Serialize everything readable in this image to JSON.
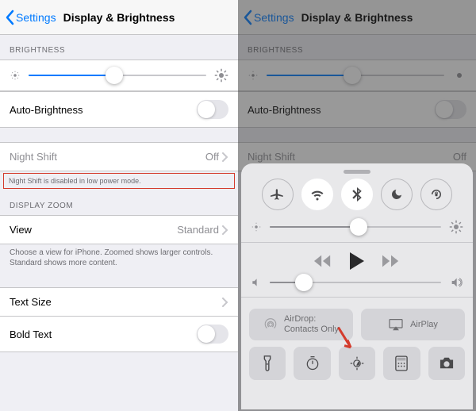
{
  "left": {
    "back": "Settings",
    "title": "Display & Brightness",
    "brightness_header": "BRIGHTNESS",
    "brightness_value": 48,
    "auto_brightness_label": "Auto-Brightness",
    "auto_brightness_on": false,
    "night_shift_label": "Night Shift",
    "night_shift_value": "Off",
    "night_shift_warning": "Night Shift is disabled in low power mode.",
    "zoom_header": "DISPLAY ZOOM",
    "view_label": "View",
    "view_value": "Standard",
    "zoom_footer": "Choose a view for iPhone. Zoomed shows larger controls. Standard shows more content.",
    "text_size_label": "Text Size",
    "bold_text_label": "Bold Text",
    "bold_text_on": false
  },
  "right": {
    "back": "Settings",
    "title": "Display & Brightness",
    "brightness_header": "BRIGHTNESS",
    "brightness_value": 48,
    "auto_brightness_label": "Auto-Brightness",
    "night_shift_label": "Night Shift",
    "night_shift_value": "Off",
    "night_shift_warning": "Night Shift is disabled in low power mode."
  },
  "cc": {
    "toggles": {
      "airplane": false,
      "wifi": true,
      "bluetooth": true,
      "dnd": false,
      "rotation_lock": false
    },
    "brightness": 52,
    "volume": 20,
    "airdrop_title": "AirDrop:",
    "airdrop_value": "Contacts Only",
    "airplay_label": "AirPlay",
    "bottom": {
      "flashlight": "flashlight-icon",
      "timer": "timer-icon",
      "night_shift": "night-shift-icon",
      "calculator": "calculator-icon",
      "camera": "camera-icon"
    }
  }
}
